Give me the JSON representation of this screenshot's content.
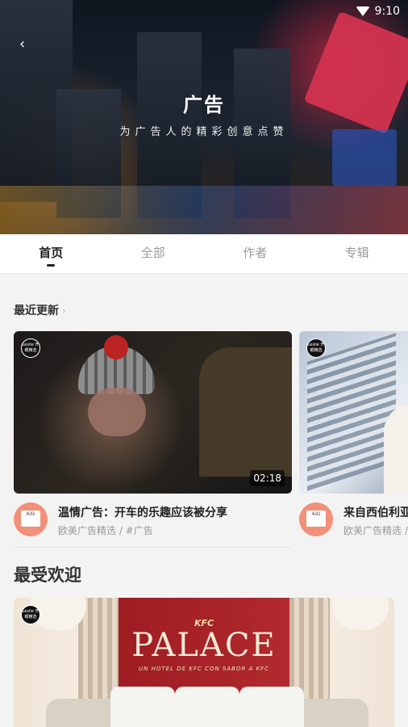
{
  "status": {
    "time": "9:10"
  },
  "header": {
    "back_icon": "back-chevron-icon",
    "title": "广告",
    "subtitle": "为广告人的精彩创意点赞"
  },
  "tabs": [
    {
      "label": "首页",
      "active": true
    },
    {
      "label": "全部",
      "active": false
    },
    {
      "label": "作者",
      "active": false
    },
    {
      "label": "专辑",
      "active": false
    }
  ],
  "recent": {
    "heading": "最近更新",
    "videos": [
      {
        "duration": "02:18",
        "title": "温情广告：开车的乐趣应该被分享",
        "meta": "欧美广告精选 / #广告"
      },
      {
        "title": "来自西伯利亚",
        "meta": "欧美广告精选 /"
      }
    ]
  },
  "popular": {
    "heading": "最受欢迎",
    "hero_text": {
      "brand": "KFC",
      "headline": "PALACE",
      "tagline": "UN HOTEL DE KFC CON SABOR A KFC"
    }
  },
  "badge_text": "Leslie 开眼精选",
  "avatar_text": "Ads"
}
